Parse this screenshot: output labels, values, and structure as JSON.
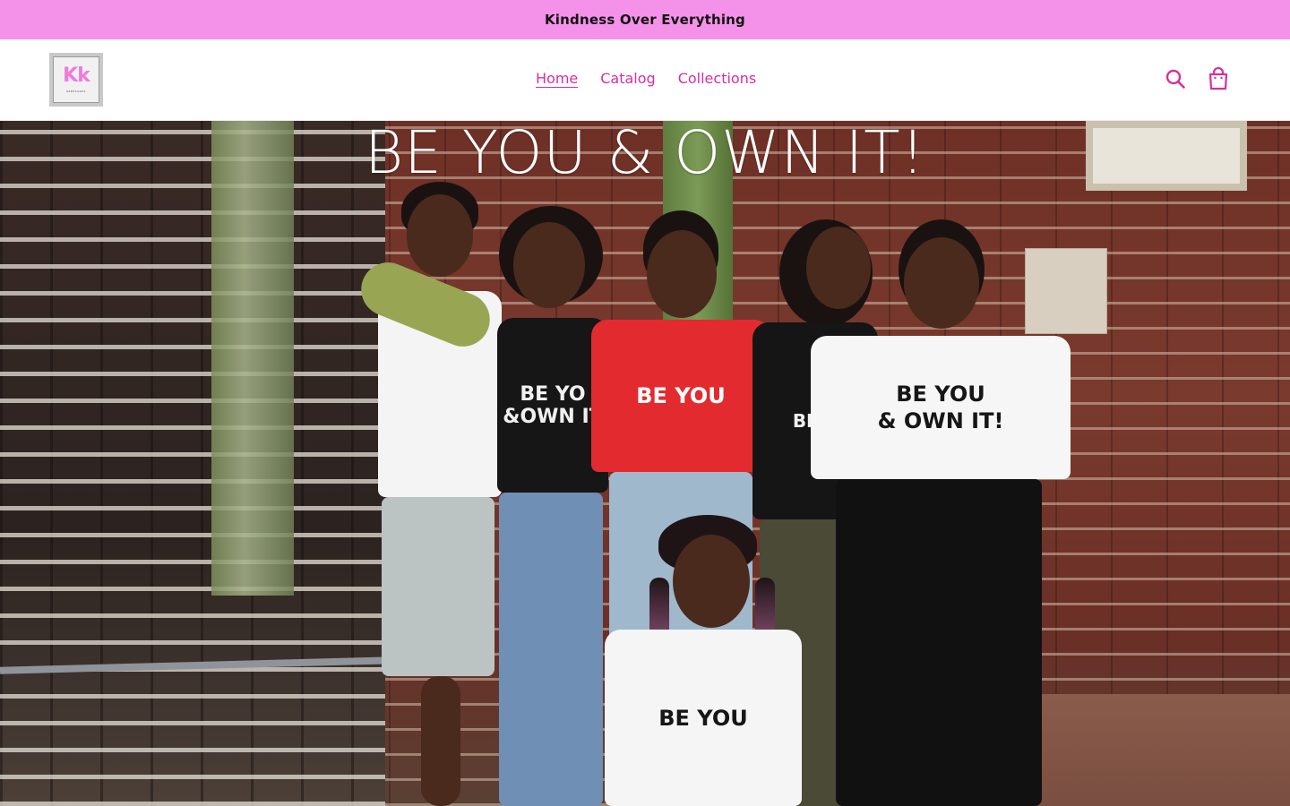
{
  "announcement": {
    "text": "Kindness Over Everything"
  },
  "header": {
    "logo": {
      "mark": "Kk",
      "subtitle": "KEEPSAKES"
    },
    "nav": [
      {
        "label": "Home",
        "active": true
      },
      {
        "label": "Catalog",
        "active": false
      },
      {
        "label": "Collections",
        "active": false
      }
    ],
    "icons": {
      "search": "search-icon",
      "cart": "cart-icon"
    }
  },
  "hero": {
    "title": "BE YOU & OWN IT!",
    "shirts": {
      "p1": "",
      "p2": "BE YO\n&OWN IT",
      "p3": "BE YOU",
      "p4": "BE Y",
      "p5": "BE YOU\n& OWN IT!",
      "p6": "BE YOU"
    }
  },
  "colors": {
    "announcement_bg": "#f491e8",
    "accent": "#d5309f",
    "logo_pink": "#ef7bdc"
  }
}
